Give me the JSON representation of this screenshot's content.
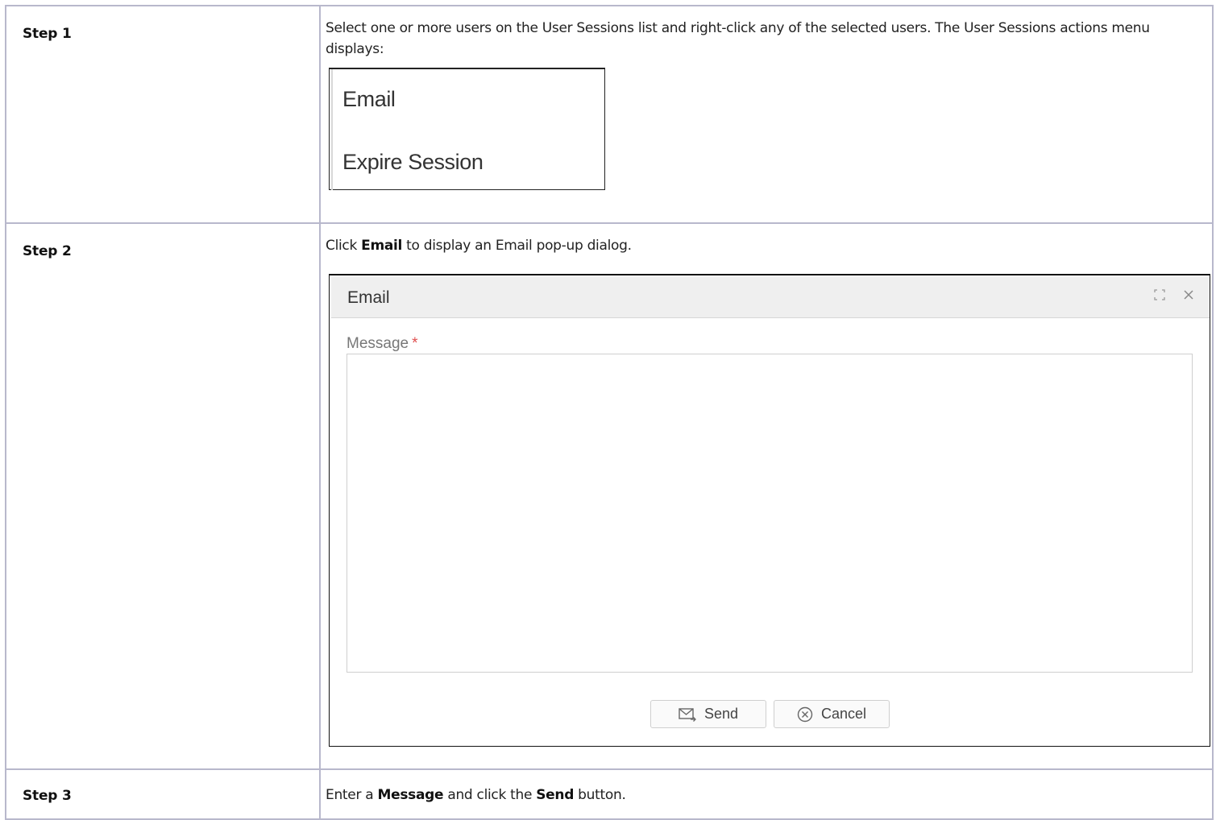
{
  "steps": [
    {
      "label": "Step 1",
      "text": "Select one or more users on the User Sessions list and right-click any of the selected users. The User Sessions actions menu displays:",
      "menu": {
        "items": [
          "Email",
          "Expire Session"
        ]
      }
    },
    {
      "label": "Step 2",
      "text_pre": "Click ",
      "text_bold": "Email",
      "text_post": " to display an Email pop-up dialog.",
      "dialog": {
        "title": "Email",
        "message_label": "Message",
        "required_mark": "*",
        "message_value": "",
        "send_label": "Send",
        "cancel_label": "Cancel",
        "icons": [
          "maximize-icon",
          "close-icon",
          "send-mail-icon",
          "cancel-circle-icon"
        ]
      }
    },
    {
      "label": "Step 3",
      "text_1": "Enter a ",
      "bold_1": "Message",
      "text_2": " and click the ",
      "bold_2": "Send",
      "text_3": " button."
    }
  ],
  "colors": {
    "border": "#b8b8cc",
    "required": "#e05050",
    "dialog_header": "#efefef"
  }
}
